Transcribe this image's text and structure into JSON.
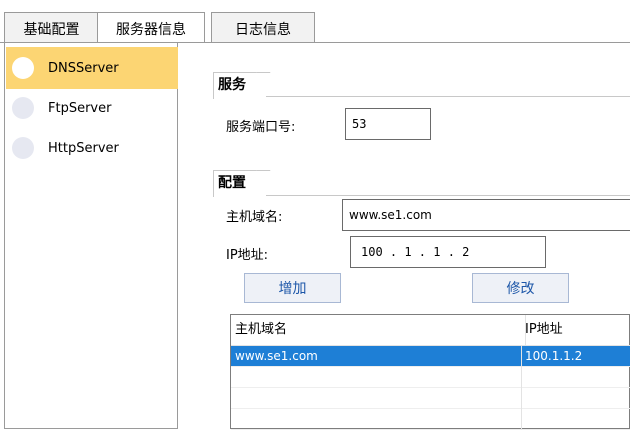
{
  "tabs": [
    {
      "label": "基础配置",
      "active": false
    },
    {
      "label": "服务器信息",
      "active": true
    },
    {
      "label": "日志信息",
      "active": false
    }
  ],
  "sidebar": {
    "items": [
      {
        "label": "DNSServer",
        "selected": true
      },
      {
        "label": "FtpServer",
        "selected": false
      },
      {
        "label": "HttpServer",
        "selected": false
      }
    ]
  },
  "service": {
    "group_title": "服务",
    "port_label": "服务端口号:",
    "port_value": "53"
  },
  "config": {
    "group_title": "配置",
    "host_label": "主机域名:",
    "host_value": "www.se1.com",
    "ip_label": "IP地址:",
    "ip_value": "100 . 1 . 1 . 2",
    "add_button": "增加",
    "edit_button": "修改"
  },
  "table": {
    "columns": [
      "主机域名",
      "IP地址"
    ],
    "rows": [
      {
        "host": "www.se1.com",
        "ip": "100.1.1.2",
        "selected": true
      }
    ]
  },
  "colors": {
    "selected_side": "#fcd573",
    "table_selected": "#1e7fd6",
    "button_text": "#1c56a8"
  }
}
